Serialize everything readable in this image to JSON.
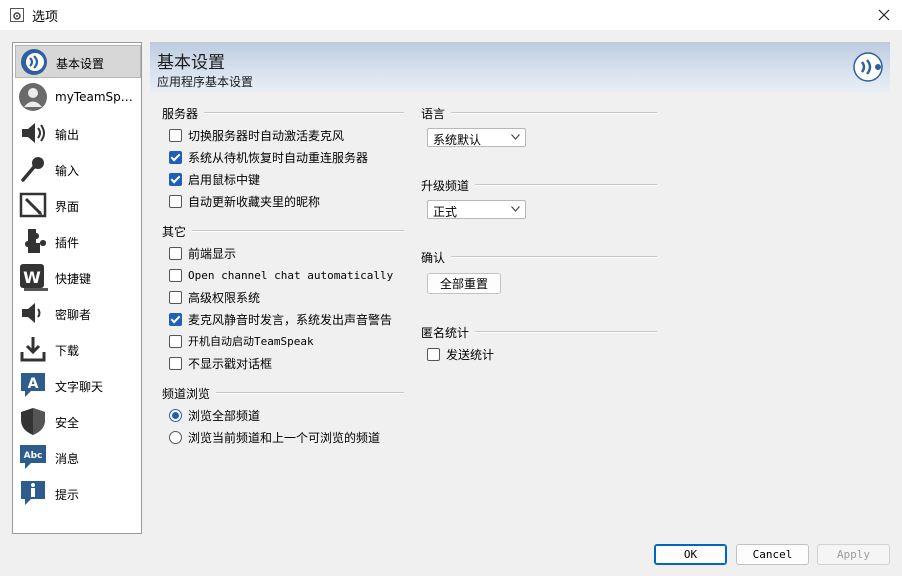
{
  "window": {
    "title": "选项"
  },
  "sidebar": {
    "items": [
      {
        "label": "基本设置",
        "icon": "teamspeak-logo-icon",
        "selected": true
      },
      {
        "label": "myTeamSpeak",
        "icon": "user-profile-icon"
      },
      {
        "label": "输出",
        "icon": "speaker-icon"
      },
      {
        "label": "输入",
        "icon": "microphone-icon"
      },
      {
        "label": "界面",
        "icon": "pen-interface-icon"
      },
      {
        "label": "插件",
        "icon": "puzzle-plugin-icon"
      },
      {
        "label": "快捷键",
        "icon": "hotkey-w-icon"
      },
      {
        "label": "密聊者",
        "icon": "whisper-speaker-icon"
      },
      {
        "label": "下载",
        "icon": "download-icon"
      },
      {
        "label": "文字聊天",
        "icon": "chat-a-icon"
      },
      {
        "label": "安全",
        "icon": "shield-icon"
      },
      {
        "label": "消息",
        "icon": "abc-message-icon"
      },
      {
        "label": "提示",
        "icon": "info-icon"
      }
    ]
  },
  "header": {
    "title": "基本设置",
    "subtitle": "应用程序基本设置"
  },
  "server": {
    "title": "服务器",
    "options": [
      {
        "label": "切换服务器时自动激活麦克风",
        "checked": false
      },
      {
        "label": "系统从待机恢复时自动重连服务器",
        "checked": true
      },
      {
        "label": "启用鼠标中键",
        "checked": true
      },
      {
        "label": "自动更新收藏夹里的昵称",
        "checked": false
      }
    ]
  },
  "other": {
    "title": "其它",
    "options": [
      {
        "label": "前端显示",
        "checked": false
      },
      {
        "label": "Open channel chat automatically",
        "checked": false
      },
      {
        "label": "高级权限系统",
        "checked": false
      },
      {
        "label": "麦克风静音时发言，系统发出声音警告",
        "checked": true
      },
      {
        "label": "开机自动启动TeamSpeak",
        "checked": false
      },
      {
        "label": "不显示戳对话框",
        "checked": false
      }
    ]
  },
  "channel_browse": {
    "title": "频道浏览",
    "options": [
      {
        "label": "浏览全部频道",
        "checked": true
      },
      {
        "label": "浏览当前频道和上一个可浏览的频道",
        "checked": false
      }
    ]
  },
  "language": {
    "title": "语言",
    "value": "系统默认"
  },
  "upgrade_channel": {
    "title": "升级频道",
    "value": "正式"
  },
  "confirm": {
    "title": "确认",
    "reset_label": "全部重置"
  },
  "anon_stats": {
    "title": "匿名统计",
    "option_label": "发送统计",
    "checked": false
  },
  "footer": {
    "ok_label": "OK",
    "cancel_label": "Cancel",
    "apply_label": "Apply"
  },
  "colors": {
    "accent": "#1f5fb7",
    "header_gradient_top": "#bccbe0",
    "header_gradient_bottom": "#e9eef5",
    "primary_button_border": "#0067c0"
  }
}
